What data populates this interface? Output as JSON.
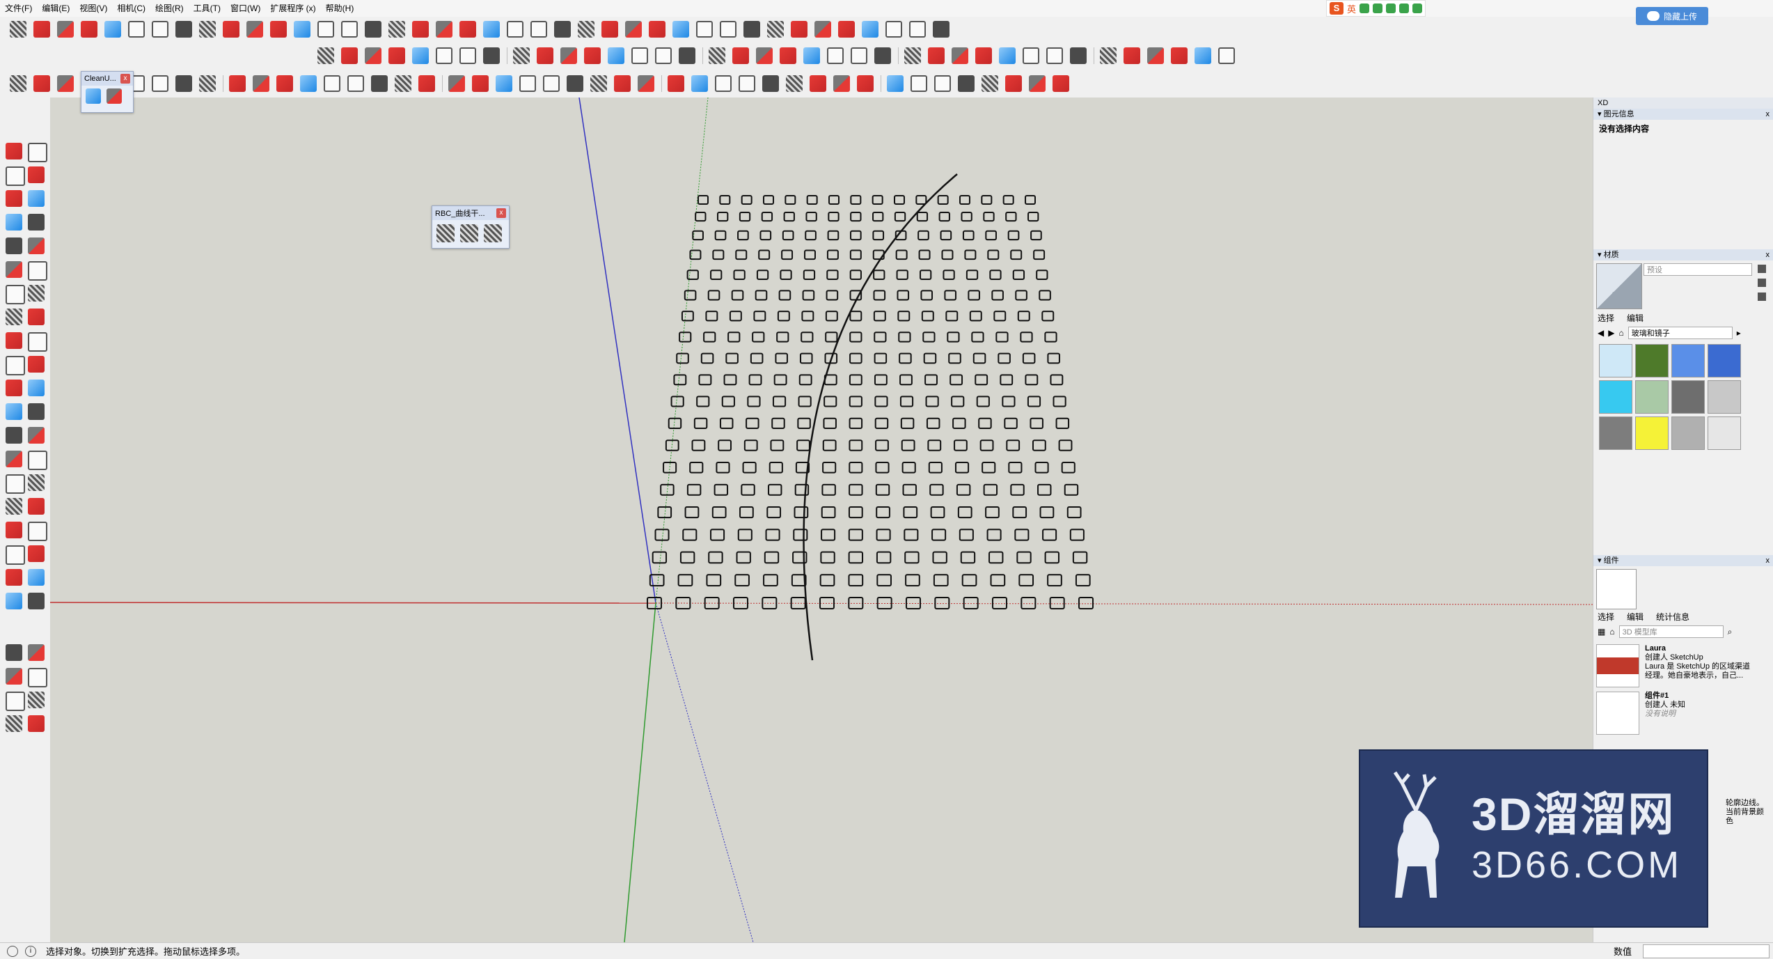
{
  "menu": [
    "文件(F)",
    "编辑(E)",
    "视图(V)",
    "相机(C)",
    "绘图(R)",
    "工具(T)",
    "窗口(W)",
    "扩展程序 (x)",
    "帮助(H)"
  ],
  "ime": {
    "logo": "S",
    "mode": "英"
  },
  "upload_label": "隐藏上传",
  "toolbars": {
    "row1_count": 40,
    "row2_count": 38,
    "row3_count": 44
  },
  "cleanup_window": {
    "title": "CleanU...",
    "close": "x"
  },
  "rbc_window": {
    "title": "RBC_曲线干...",
    "close": "x"
  },
  "right_panel": {
    "tray_title": "XD",
    "entity_info": {
      "header": "图元信息",
      "text": "没有选择内容",
      "close": "x"
    },
    "materials": {
      "header": "材质",
      "close": "x",
      "name_placeholder": "预设",
      "tabs": [
        "选择",
        "编辑"
      ],
      "library": "玻璃和镜子",
      "swatches": [
        "#cfe8f7",
        "#4e7a2a",
        "#5a8fe8",
        "#3b6bd1",
        "#37c9f0",
        "#a9c9a6",
        "#6e6e6e",
        "#c8c8c8",
        "#7d7d7d",
        "#f5f237",
        "#b0b0b0",
        "#e6e6e6"
      ]
    },
    "components": {
      "header": "组件",
      "close": "x",
      "tabs": [
        "选择",
        "编辑",
        "统计信息"
      ],
      "search_placeholder": "3D 模型库",
      "items": [
        {
          "name": "Laura",
          "line1": "创建人 SketchUp",
          "line2": "Laura 是 SketchUp 的区域渠道",
          "line3": "经理。她自豪地表示，自己..."
        },
        {
          "name": "组件#1",
          "line1": "创建人 未知",
          "line2": "没有说明",
          "line3": ""
        }
      ],
      "partial_text": [
        "轮廓边线。",
        "当前背景颜色"
      ]
    }
  },
  "status": {
    "icon": "i",
    "text": "选择对象。切换到扩充选择。拖动鼠标选择多项。",
    "value_label": "数值"
  },
  "watermark": {
    "big": "3D溜溜网",
    "small": "3D66.COM"
  }
}
